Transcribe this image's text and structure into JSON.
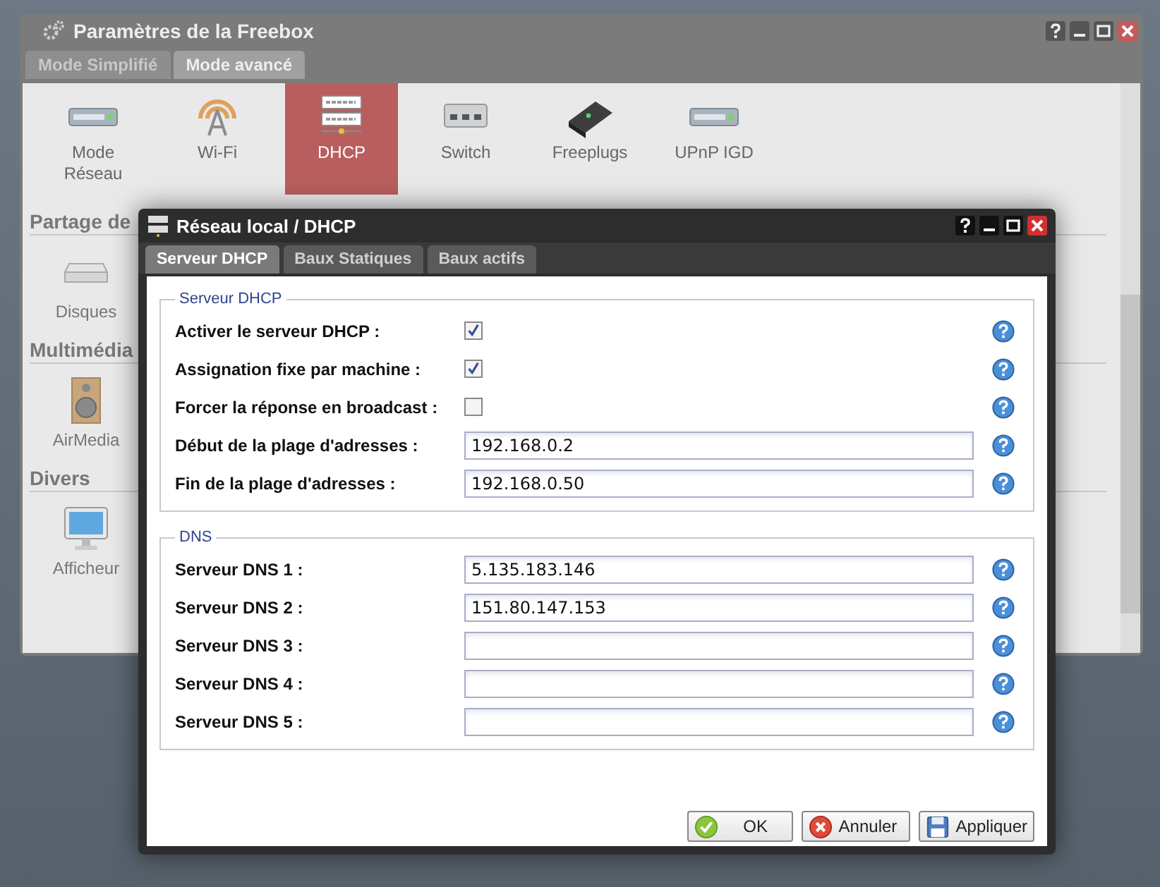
{
  "settings_window": {
    "title": "Paramètres de la Freebox",
    "tabs": [
      {
        "label": "Mode Simplifié",
        "selected": false
      },
      {
        "label": "Mode avancé",
        "selected": true
      }
    ],
    "toolbar_items": [
      {
        "label": "Mode Réseau",
        "kind": "device",
        "selected": false
      },
      {
        "label": "Wi-Fi",
        "kind": "antenna",
        "selected": false
      },
      {
        "label": "DHCP",
        "kind": "labels",
        "selected": true
      },
      {
        "label": "Switch",
        "kind": "switch",
        "selected": false
      },
      {
        "label": "Freeplugs",
        "kind": "plug",
        "selected": false
      },
      {
        "label": "UPnP IGD",
        "kind": "device",
        "selected": false
      }
    ],
    "sections": [
      {
        "title": "Partage de",
        "items": [
          {
            "label": "Disques",
            "kind": "disk"
          }
        ]
      },
      {
        "title": "Multimédia",
        "items": [
          {
            "label": "AirMedia",
            "kind": "speaker"
          }
        ]
      },
      {
        "title": "Divers",
        "items": [
          {
            "label": "Afficheur",
            "kind": "monitor"
          }
        ]
      }
    ]
  },
  "dialog": {
    "title": "Réseau local / DHCP",
    "tabs": [
      {
        "label": "Serveur DHCP",
        "selected": true
      },
      {
        "label": "Baux Statiques",
        "selected": false
      },
      {
        "label": "Baux actifs",
        "selected": false
      }
    ],
    "fieldsets": [
      {
        "legend": "Serveur DHCP",
        "fields": [
          {
            "kind": "checkbox",
            "label": "Activer le serveur DHCP :",
            "checked": true
          },
          {
            "kind": "checkbox",
            "label": "Assignation fixe par machine :",
            "checked": true
          },
          {
            "kind": "checkbox",
            "label": "Forcer la réponse en broadcast :",
            "checked": false
          },
          {
            "kind": "text",
            "label": "Début de la plage d'adresses :",
            "value": "192.168.0.2"
          },
          {
            "kind": "text",
            "label": "Fin de la plage d'adresses :",
            "value": "192.168.0.50"
          }
        ]
      },
      {
        "legend": "DNS",
        "fields": [
          {
            "kind": "text",
            "label": "Serveur DNS 1 :",
            "value": "5.135.183.146"
          },
          {
            "kind": "text",
            "label": "Serveur DNS 2 :",
            "value": "151.80.147.153"
          },
          {
            "kind": "text",
            "label": "Serveur DNS 3 :"
          },
          {
            "kind": "text",
            "label": "Serveur DNS 4 :"
          },
          {
            "kind": "text",
            "label": "Serveur DNS 5 :"
          }
        ]
      }
    ],
    "buttons": [
      {
        "kind": "ok",
        "label": "OK"
      },
      {
        "kind": "cancel",
        "label": "Annuler"
      },
      {
        "kind": "apply",
        "label": "Appliquer"
      }
    ]
  }
}
